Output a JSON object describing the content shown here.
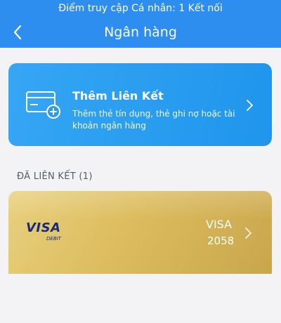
{
  "status_bar": {
    "text": "Điểm truy cập Cá nhân: 1 Kết nối"
  },
  "nav": {
    "title": "Ngân hàng",
    "back_icon": "chevron-left-icon"
  },
  "add_link": {
    "title": "Thêm Liên Kết",
    "subtitle": "Thêm thẻ tín dụng, thẻ ghi nợ hoặc tài khoản ngân hàng",
    "icon": "add-card-icon",
    "color": "#2d9bf0"
  },
  "linked_section": {
    "label": "ĐÃ LIÊN KẾT (1)"
  },
  "cards": [
    {
      "logo": "VISA",
      "logo_sub": "DEBIT",
      "brand": "VISA",
      "last4": "2058",
      "color": "#d9b95c"
    }
  ],
  "colors": {
    "header": "#2d8ef0",
    "background": "#f3f3f5"
  }
}
